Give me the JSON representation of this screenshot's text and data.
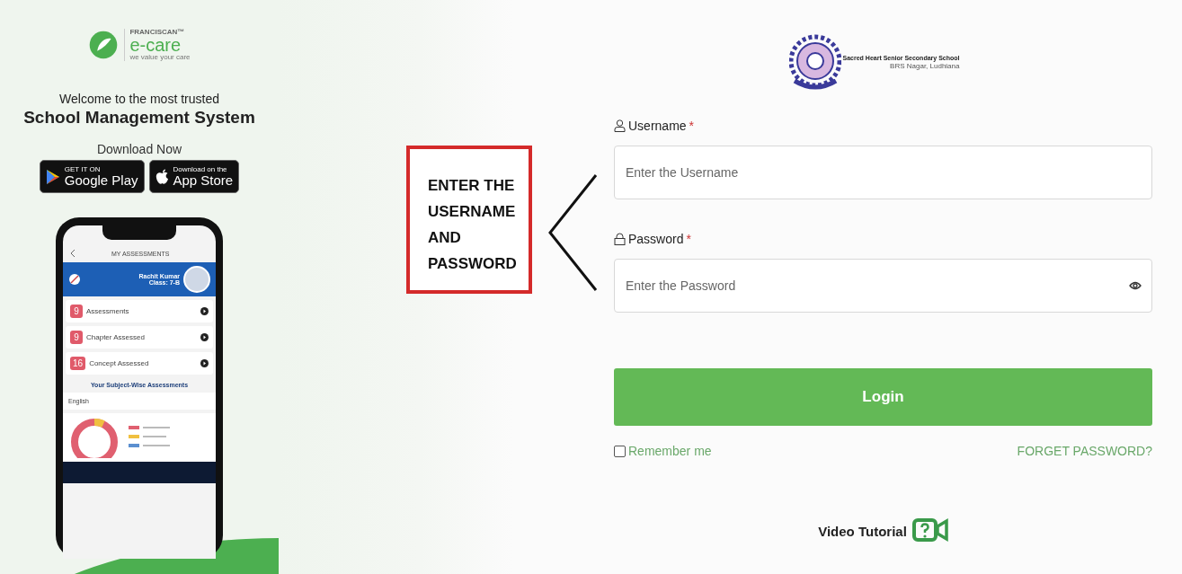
{
  "brand": {
    "small": "FRANCISCAN™",
    "name": "e-care",
    "tagline": "we value your care"
  },
  "welcome": "Welcome to the most trusted",
  "headline": "School Management System",
  "download_label": "Download Now",
  "store_buttons": [
    {
      "kind": "google",
      "small": "GET IT ON",
      "name": "Google Play"
    },
    {
      "kind": "apple",
      "small": "Download on the",
      "name": "App Store"
    }
  ],
  "phone": {
    "title": "MY ASSESSMENTS",
    "student_name": "Rachit Kumar",
    "student_class": "Class: 7-B",
    "stats": [
      {
        "count": "9",
        "label": "Assessments"
      },
      {
        "count": "9",
        "label": "Chapter Assessed"
      },
      {
        "count": "16",
        "label": "Concept Assessed"
      }
    ],
    "section_title": "Your Subject-Wise Assessments",
    "subject": "English"
  },
  "callout": {
    "lines": [
      "ENTER THE",
      "USERNAME",
      "AND",
      "PASSWORD"
    ]
  },
  "school": {
    "name": "Sacred Heart Senior Secondary School",
    "address": "BRS Nagar, Ludhiana"
  },
  "fields": [
    {
      "kind": "text",
      "label": "Username",
      "marker": "*",
      "placeholder": "Enter the Username"
    },
    {
      "kind": "password",
      "label": "Password",
      "marker": "*",
      "placeholder": "Enter the Password"
    }
  ],
  "login_button": "Login",
  "remember": {
    "label": "Remember me",
    "checked": false
  },
  "forgot_link": "FORGET PASSWORD?",
  "video_tutorial": "Video Tutorial"
}
